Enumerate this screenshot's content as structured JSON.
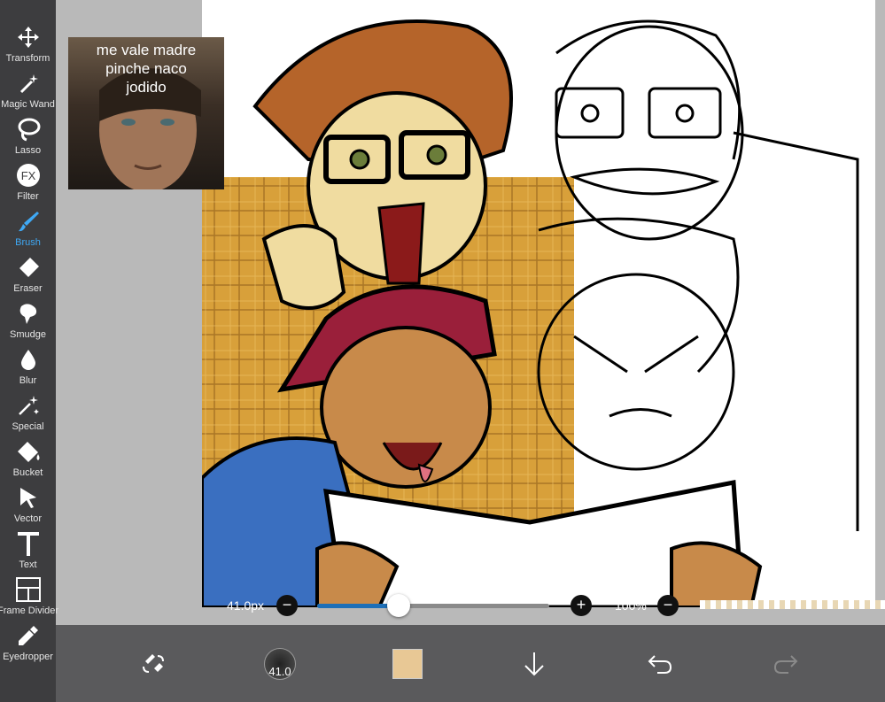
{
  "toolbar": {
    "tools": [
      {
        "label": "Transform",
        "icon": "move-arrows-icon"
      },
      {
        "label": "Magic Wand",
        "icon": "magic-wand-icon"
      },
      {
        "label": "Lasso",
        "icon": "lasso-icon"
      },
      {
        "label": "Filter",
        "icon": "fx-filter-icon"
      },
      {
        "label": "Brush",
        "icon": "brush-icon"
      },
      {
        "label": "Eraser",
        "icon": "eraser-icon"
      },
      {
        "label": "Smudge",
        "icon": "smudge-icon"
      },
      {
        "label": "Blur",
        "icon": "blur-drop-icon"
      },
      {
        "label": "Special",
        "icon": "sparkle-icon"
      },
      {
        "label": "Bucket",
        "icon": "bucket-icon"
      },
      {
        "label": "Vector",
        "icon": "cursor-arrow-icon"
      },
      {
        "label": "Text",
        "icon": "text-t-icon"
      },
      {
        "label": "Frame Divider",
        "icon": "frame-divider-icon"
      },
      {
        "label": "Eyedropper",
        "icon": "eyedropper-icon"
      }
    ],
    "active_tool": "Brush",
    "active_color": "#3fa9f5",
    "filter_icon_text": "FX"
  },
  "reference_image": {
    "caption": "me vale madre\npinche naco\njodido"
  },
  "brush_slider": {
    "size_label": "41.0px",
    "opacity_label": "100%",
    "minus": "−",
    "plus": "+",
    "size_fraction": 0.35
  },
  "bottom_bar": {
    "brush_size_value": "41.0",
    "current_color": "#e8c895"
  }
}
